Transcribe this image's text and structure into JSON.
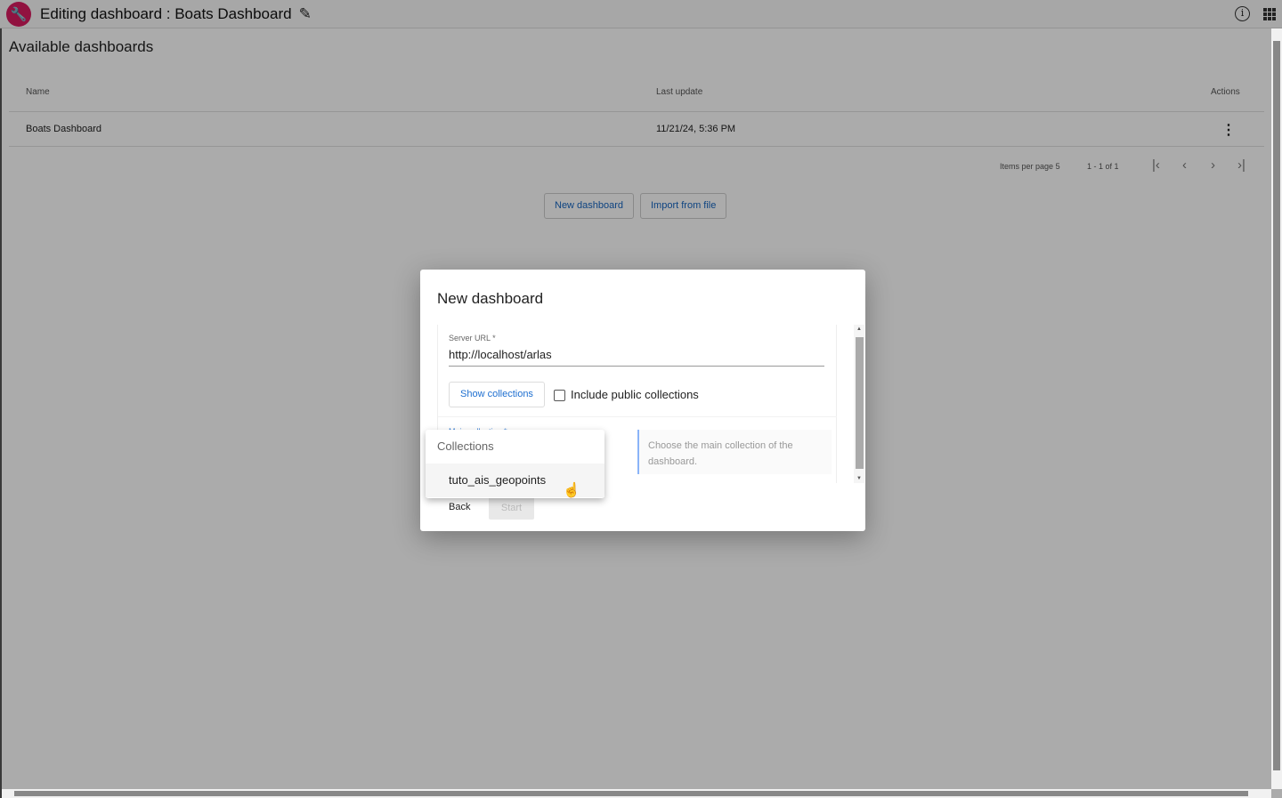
{
  "header": {
    "title": "Editing dashboard : Boats Dashboard",
    "logo_icon": "wrench-icon",
    "edit_icon": "pencil-icon",
    "info_icon": "info-icon",
    "apps_icon": "apps-grid-icon"
  },
  "page": {
    "heading": "Available dashboards"
  },
  "table": {
    "columns": [
      "Name",
      "Last update",
      "Actions"
    ],
    "rows": [
      {
        "name": "Boats Dashboard",
        "last_update": "11/21/24, 5:36 PM",
        "actions_icon": "more-vert-icon"
      }
    ],
    "paginator": {
      "items_per_page_label": "Items per page",
      "items_per_page": "5",
      "range": "1 - 1 of 1"
    }
  },
  "buttons": {
    "new_dashboard": "New dashboard",
    "import": "Import from file"
  },
  "dialog": {
    "title": "New dashboard",
    "server_url_label": "Server URL *",
    "server_url": "http://localhost/arlas",
    "show_collections": "Show collections",
    "include_public": "Include public collections",
    "include_public_checked": false,
    "main_collection_label": "Main collection *",
    "help": "Choose the main collection of the dashboard.",
    "back": "Back",
    "start": "Start"
  },
  "dropdown": {
    "header": "Collections",
    "options": [
      "tuto_ais_geopoints"
    ]
  },
  "colors": {
    "brand": "#d81b60",
    "link": "#1e6fd0"
  }
}
